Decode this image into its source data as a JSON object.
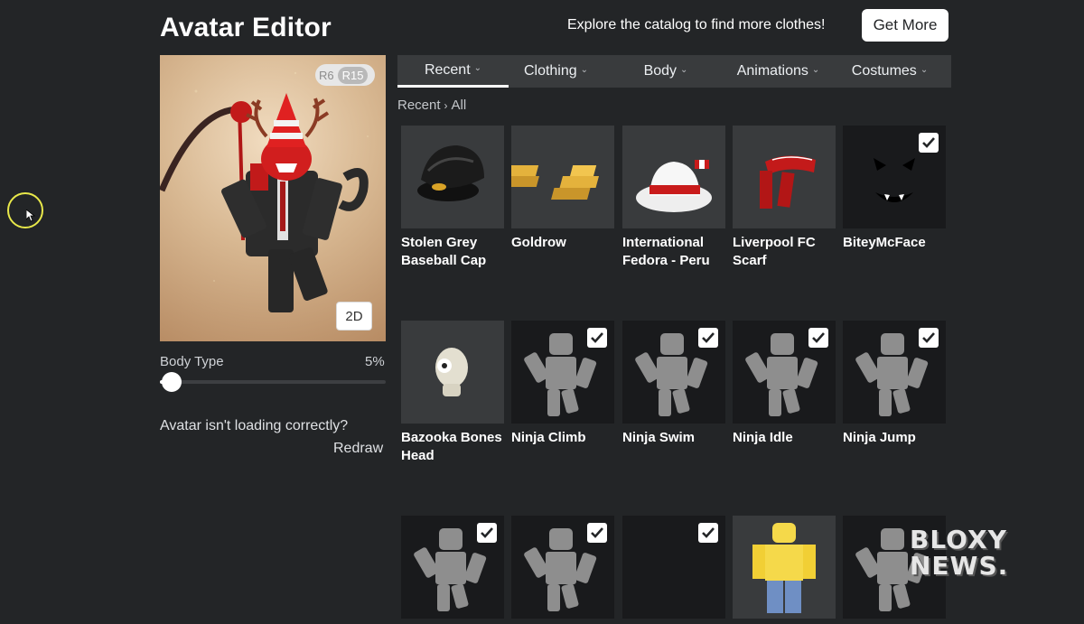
{
  "header": {
    "title": "Avatar Editor",
    "promo_text": "Explore the catalog to find more clothes!",
    "get_more_label": "Get More"
  },
  "avatar_preview": {
    "rig_options": [
      "R6",
      "R15"
    ],
    "rig_selected": "R15",
    "view_toggle_label": "2D"
  },
  "body_type": {
    "label": "Body Type",
    "value_text": "5%",
    "value": 0.05
  },
  "loading_help": {
    "text": "Avatar isn't loading correctly?",
    "redraw_label": "Redraw"
  },
  "tabs": [
    {
      "label": "Recent",
      "active": true
    },
    {
      "label": "Clothing",
      "active": false
    },
    {
      "label": "Body",
      "active": false
    },
    {
      "label": "Animations",
      "active": false
    },
    {
      "label": "Costumes",
      "active": false
    }
  ],
  "breadcrumb": {
    "root": "Recent",
    "current": "All"
  },
  "items": [
    {
      "name": "Stolen Grey Baseball Cap",
      "checked": false,
      "icon": "baseball-cap"
    },
    {
      "name": "Goldrow",
      "checked": false,
      "icon": "gold-bars"
    },
    {
      "name": "International Fedora - Peru",
      "checked": false,
      "icon": "fedora"
    },
    {
      "name": "Liverpool FC Scarf",
      "checked": false,
      "icon": "scarf"
    },
    {
      "name": "BiteyMcFace",
      "checked": true,
      "icon": "face"
    },
    {
      "name": "Bazooka Bones Head",
      "checked": false,
      "icon": "skull-head"
    },
    {
      "name": "Ninja Climb",
      "checked": true,
      "icon": "animation-figure"
    },
    {
      "name": "Ninja Swim",
      "checked": true,
      "icon": "animation-figure"
    },
    {
      "name": "Ninja Idle",
      "checked": true,
      "icon": "animation-figure"
    },
    {
      "name": "Ninja Jump",
      "checked": true,
      "icon": "animation-figure"
    },
    {
      "name": "",
      "checked": true,
      "icon": "animation-figure"
    },
    {
      "name": "",
      "checked": true,
      "icon": "animation-figure"
    },
    {
      "name": "",
      "checked": true,
      "icon": "animation-figure"
    },
    {
      "name": "",
      "checked": false,
      "icon": "avatar-figure"
    },
    {
      "name": "",
      "checked": false,
      "icon": "animation-figure"
    }
  ],
  "watermark": {
    "line1": "BLOXY",
    "line2": "NEWS."
  },
  "colors": {
    "background": "#232527",
    "tab_bar": "#393b3d",
    "accent": "#ffffff"
  }
}
